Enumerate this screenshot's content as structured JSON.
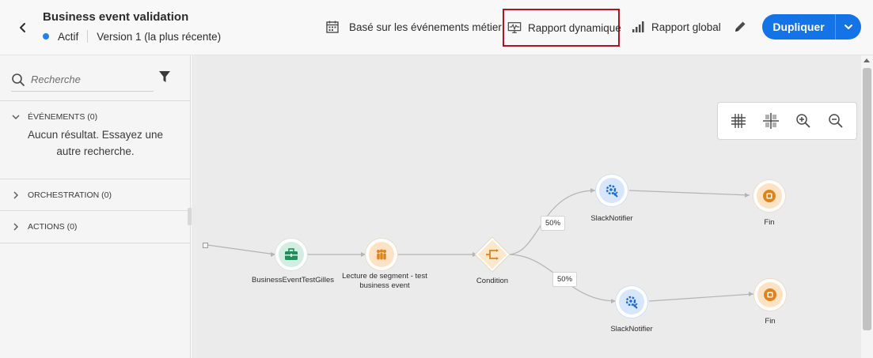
{
  "header": {
    "back_icon": "chevron-left-icon",
    "title": "Business event validation",
    "status": "Actif",
    "version": "Version 1 (la plus récente)",
    "business_events_label": "Basé sur les événements métier",
    "dynamic_report_label": "Rapport dynamique",
    "global_report_label": "Rapport global",
    "duplicate_label": "Dupliquer",
    "colors": {
      "accent": "#1473e6",
      "status_dot": "#2680eb",
      "highlight_border": "#b3141b"
    }
  },
  "sidebar": {
    "search_placeholder": "Recherche",
    "sections": [
      {
        "label": "ÉVÉNEMENTS (0)",
        "expanded": true,
        "empty_text": "Aucun résultat. Essayez une autre recherche."
      },
      {
        "label": "ORCHESTRATION (0)",
        "expanded": false
      },
      {
        "label": "ACTIONS (0)",
        "expanded": false
      }
    ]
  },
  "canvas": {
    "zoom_controls": [
      "grid-icon",
      "align-icon",
      "zoom-in-icon",
      "zoom-out-icon"
    ],
    "nodes": {
      "event": "BusinessEventTestGilles",
      "segment_line1": "Lecture de segment - test",
      "segment_line2": "business event",
      "condition": "Condition",
      "slack_top": "SlackNotifier",
      "slack_bottom": "SlackNotifier",
      "end_top": "Fin",
      "end_bottom": "Fin"
    },
    "split_top": "50%",
    "split_bottom": "50%"
  }
}
